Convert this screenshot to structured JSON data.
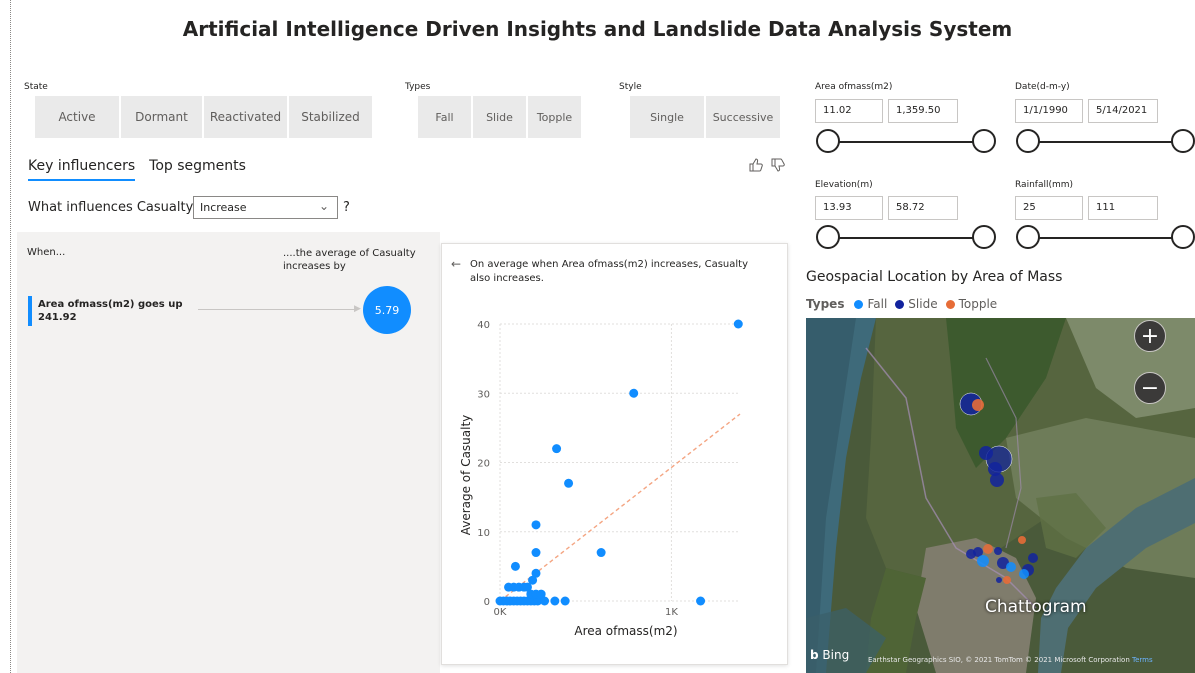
{
  "title": "Artificial Intelligence Driven Insights and Landslide Data Analysis System",
  "slicers": {
    "state": {
      "label": "State",
      "options": [
        "Active",
        "Dormant",
        "Reactivated",
        "Stabilized"
      ]
    },
    "types": {
      "label": "Types",
      "options": [
        "Fall",
        "Slide",
        "Topple"
      ]
    },
    "style": {
      "label": "Style",
      "options": [
        "Single",
        "Successive"
      ]
    }
  },
  "tabs": {
    "key_influencers": "Key influencers",
    "top_segments": "Top segments"
  },
  "feedback": {
    "like_icon": "thumbs-up-icon",
    "dislike_icon": "thumbs-down-icon"
  },
  "question": {
    "prefix": "What influences Casualty to",
    "dropdown_value": "Increase",
    "suffix": "?"
  },
  "influencer_panel": {
    "when_header": "When...",
    "average_header": "....the average of Casualty increases by",
    "factor_line1": "Area ofmass(m2) goes up",
    "factor_line2": "241.92",
    "factor_value": "5.79"
  },
  "detail_card": {
    "back_icon": "arrow-left-icon",
    "text": "On average when Area ofmass(m2) increases, Casualty also increases."
  },
  "chart_data": {
    "type": "scatter",
    "xlabel": "Area ofmass(m2)",
    "ylabel": "Average of Casualty",
    "xlim": [
      0,
      1400
    ],
    "ylim": [
      0,
      40
    ],
    "xticks": [
      "0K",
      "1K"
    ],
    "yticks": [
      "0",
      "10",
      "20",
      "30",
      "40"
    ],
    "points": [
      [
        0,
        0
      ],
      [
        20,
        0
      ],
      [
        40,
        0
      ],
      [
        60,
        0
      ],
      [
        80,
        0
      ],
      [
        100,
        0
      ],
      [
        120,
        0
      ],
      [
        140,
        0
      ],
      [
        160,
        0
      ],
      [
        180,
        0
      ],
      [
        200,
        0
      ],
      [
        220,
        0
      ],
      [
        260,
        0
      ],
      [
        320,
        0
      ],
      [
        380,
        0
      ],
      [
        1170,
        0
      ],
      [
        50,
        2
      ],
      [
        80,
        2
      ],
      [
        110,
        2
      ],
      [
        140,
        2
      ],
      [
        160,
        2
      ],
      [
        180,
        1
      ],
      [
        210,
        1
      ],
      [
        240,
        1
      ],
      [
        190,
        3
      ],
      [
        210,
        4
      ],
      [
        90,
        5
      ],
      [
        210,
        7
      ],
      [
        590,
        7
      ],
      [
        210,
        11
      ],
      [
        400,
        17
      ],
      [
        330,
        22
      ],
      [
        780,
        30
      ],
      [
        1390,
        40
      ]
    ],
    "trend": {
      "from": [
        0,
        0
      ],
      "to": [
        1400,
        27
      ],
      "color": "#f4a582"
    },
    "point_color": "#118dff"
  },
  "range_sliders": [
    {
      "label": "Area ofmass(m2)",
      "min": "11.02",
      "max": "1,359.50"
    },
    {
      "label": "Date(d-m-y)",
      "min": "1/1/1990",
      "max": "5/14/2021"
    },
    {
      "label": "Elevation(m)",
      "min": "13.93",
      "max": "58.72"
    },
    {
      "label": "Rainfall(mm)",
      "min": "25",
      "max": "111"
    }
  ],
  "map": {
    "title": "Geospacial Location by Area of Mass",
    "legend_title": "Types",
    "legend": [
      {
        "name": "Fall",
        "color": "#118dff"
      },
      {
        "name": "Slide",
        "color": "#12239e"
      },
      {
        "name": "Topple",
        "color": "#e66c37"
      }
    ],
    "city_label": "Chattogram",
    "bing_label": "Bing",
    "attribution": "Earthstar Geographics SIO, © 2021 TomTom © 2021 Microsoft Corporation",
    "terms": "Terms",
    "zoom_in_icon": "plus-icon",
    "zoom_out_icon": "minus-icon"
  }
}
